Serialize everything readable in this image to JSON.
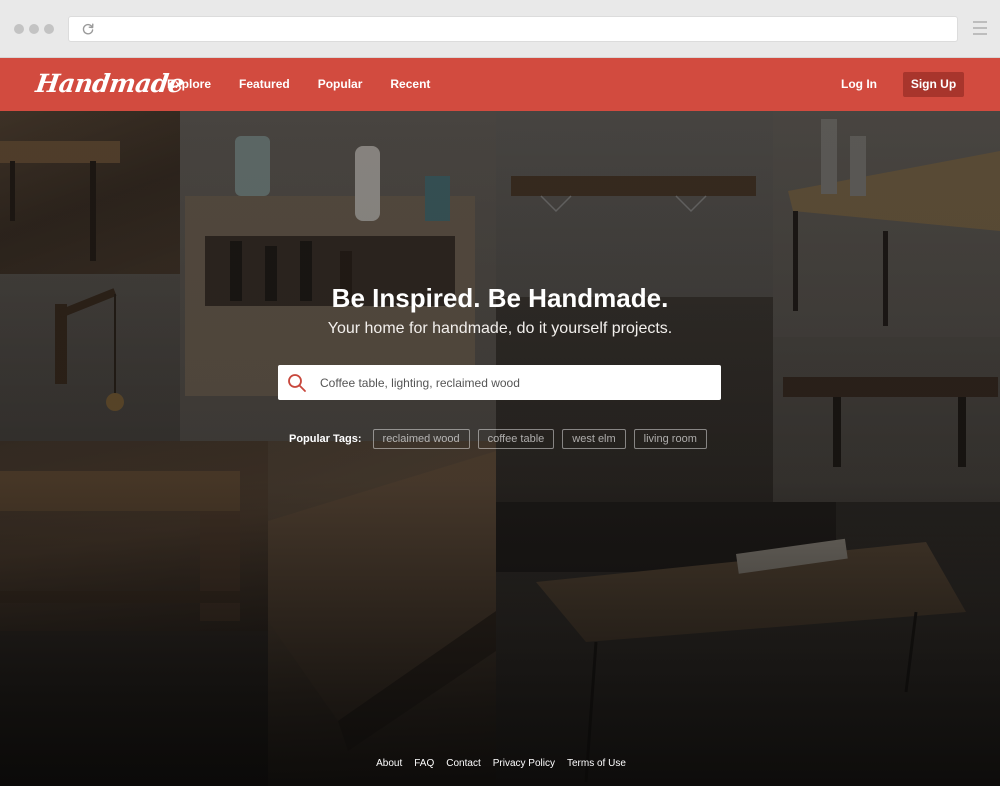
{
  "colors": {
    "brand": "#d24b3f",
    "signup_button": "#a8352c",
    "chrome": "#e9e9e9"
  },
  "nav": {
    "logo": "Handmade",
    "links": [
      "Explore",
      "Featured",
      "Popular",
      "Recent"
    ],
    "login": "Log In",
    "signup": "Sign Up"
  },
  "hero": {
    "headline": "Be Inspired. Be Handmade.",
    "subhead": "Your home for handmade, do it yourself projects."
  },
  "search": {
    "placeholder": "Coffee table, lighting, reclaimed wood",
    "icon": "search-icon"
  },
  "tags": {
    "label": "Popular Tags:",
    "items": [
      "reclaimed wood",
      "coffee table",
      "west elm",
      "living room"
    ]
  },
  "footer": {
    "links": [
      "About",
      "FAQ",
      "Contact",
      "Privacy Policy",
      "Terms of Use"
    ]
  }
}
